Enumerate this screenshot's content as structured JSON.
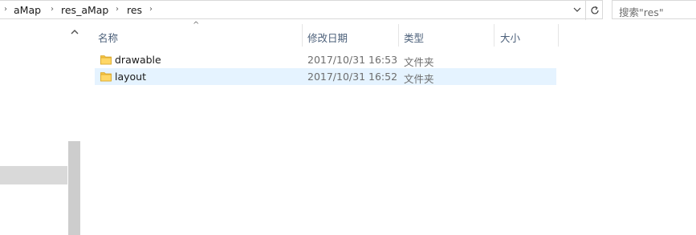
{
  "address": {
    "breadcrumbs": [
      "aMap",
      "res_aMap",
      "res"
    ],
    "separator": "›"
  },
  "search": {
    "placeholder": "搜索\"res\""
  },
  "columns": {
    "name": "名称",
    "date_modified": "修改日期",
    "type": "类型",
    "size": "大小"
  },
  "files": [
    {
      "name": "drawable",
      "date": "2017/10/31 16:53",
      "type": "文件夹",
      "size": "",
      "icon": "folder-icon",
      "selected": false
    },
    {
      "name": "layout",
      "date": "2017/10/31 16:52",
      "type": "文件夹",
      "size": "",
      "icon": "folder-icon",
      "selected": true
    }
  ],
  "colors": {
    "folder": "#f5c342",
    "selection": "#e5f3ff",
    "header_text": "#4c607a"
  }
}
